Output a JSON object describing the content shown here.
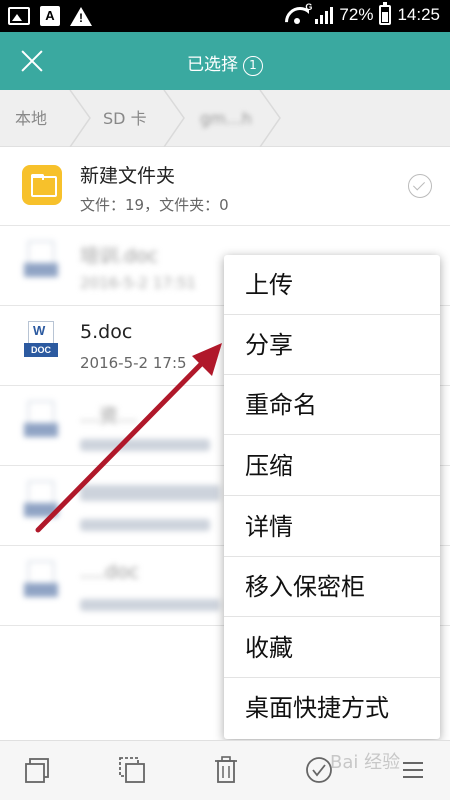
{
  "status_bar": {
    "notif_letter": "A",
    "network_type": "G",
    "battery": "72%",
    "time": "14:25"
  },
  "header": {
    "title": "已选择",
    "count": "1"
  },
  "breadcrumb": [
    {
      "label": "本地"
    },
    {
      "label": "SD 卡"
    },
    {
      "label": "gm…h",
      "blurred": true
    }
  ],
  "files": [
    {
      "name": "新建文件夹",
      "meta": "文件：19，文件夹：0",
      "type": "folder"
    },
    {
      "name": "培训.doc",
      "meta": "2016-5-2 17:51",
      "type": "doc",
      "blurred": true
    },
    {
      "name": "5.doc",
      "meta": "2016-5-2 17:5",
      "type": "doc",
      "icon_label": "DOC",
      "icon_letter": "W"
    },
    {
      "name": "…资…",
      "meta": "",
      "type": "doc",
      "blurred": true
    },
    {
      "name": "…",
      "meta": "",
      "type": "doc",
      "blurred": true
    },
    {
      "name": "….doc",
      "meta": "",
      "type": "doc",
      "blurred": true
    }
  ],
  "context_menu": [
    "上传",
    "分享",
    "重命名",
    "压缩",
    "详情",
    "移入保密柜",
    "收藏",
    "桌面快捷方式"
  ],
  "toolbar": [
    {
      "icon": "copy-icon"
    },
    {
      "icon": "move-icon"
    },
    {
      "icon": "delete-icon"
    },
    {
      "icon": "select-all-icon"
    },
    {
      "icon": "more-icon"
    }
  ],
  "watermark": "Bai 经验",
  "colors": {
    "header": "#3aa9a0",
    "folder": "#f7c12b",
    "doc_blue": "#2c5aa0",
    "arrow": "#b0182a"
  }
}
